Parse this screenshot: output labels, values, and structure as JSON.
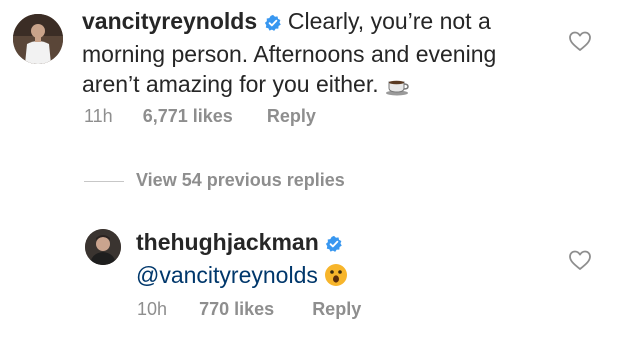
{
  "comments": [
    {
      "username": "vancityreynolds",
      "verified": true,
      "text_line1": "Clearly, you’re not a",
      "text_line2": "morning person. Afternoons and evening",
      "text_line3": "aren’t amazing for you either.",
      "emoji": "coffee-icon",
      "time": "11h",
      "likes": "6,771 likes",
      "reply_label": "Reply"
    },
    {
      "username": "thehughjackman",
      "verified": true,
      "mention": "@vancityreynolds",
      "emoji": "astonished-face-icon",
      "time": "10h",
      "likes": "770 likes",
      "reply_label": "Reply"
    }
  ],
  "view_replies_label": "View 54 previous replies",
  "colors": {
    "text": "#262626",
    "muted": "#8e8e8e",
    "verified": "#3897f0",
    "mention": "#00376b"
  }
}
